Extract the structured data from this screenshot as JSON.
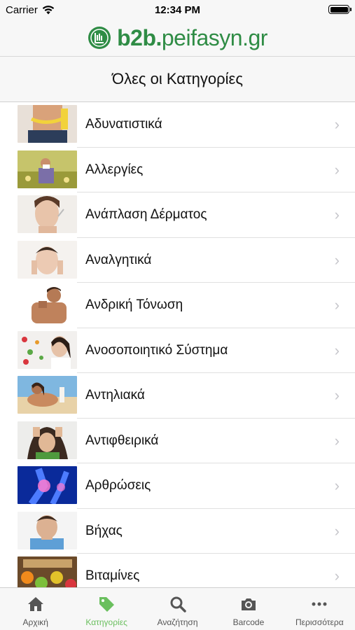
{
  "status": {
    "carrier": "Carrier",
    "time": "12:34 PM"
  },
  "brand": {
    "bold": "b2b.",
    "rest": "peifasyn.gr",
    "color": "#2f8c45"
  },
  "header": {
    "title": "Όλες οι Κατηγορίες"
  },
  "categories": [
    {
      "label": "Αδυνατιστικά",
      "thumb": "weight-loss-photo"
    },
    {
      "label": "Αλλεργίες",
      "thumb": "allergy-photo"
    },
    {
      "label": "Ανάπλαση Δέρματος",
      "thumb": "skin-photo"
    },
    {
      "label": "Αναλγητικά",
      "thumb": "painkillers-photo"
    },
    {
      "label": "Ανδρική Τόνωση",
      "thumb": "men-photo"
    },
    {
      "label": "Ανοσοποιητικό Σύστημα",
      "thumb": "immune-photo"
    },
    {
      "label": "Αντηλιακά",
      "thumb": "sunscreen-photo"
    },
    {
      "label": "Αντιφθειρικά",
      "thumb": "lice-photo"
    },
    {
      "label": "Αρθρώσεις",
      "thumb": "joints-photo"
    },
    {
      "label": "Βήχας",
      "thumb": "cough-photo"
    },
    {
      "label": "Βιταμίνες",
      "thumb": "vitamins-photo"
    }
  ],
  "tabs": [
    {
      "label": "Αρχική",
      "icon": "home-icon"
    },
    {
      "label": "Κατηγορίες",
      "icon": "tag-icon",
      "active": true
    },
    {
      "label": "Αναζήτηση",
      "icon": "search-icon"
    },
    {
      "label": "Barcode",
      "icon": "camera-icon"
    },
    {
      "label": "Περισσότερα",
      "icon": "more-icon"
    }
  ],
  "colors": {
    "accent": "#6abf5e",
    "brand": "#2f8c45"
  }
}
